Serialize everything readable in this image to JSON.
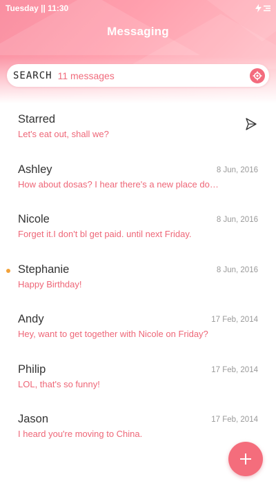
{
  "status_bar": {
    "time_text": "Tuesday || 11:30",
    "icons": [
      "charging-icon",
      "menu-lines-icon"
    ]
  },
  "header": {
    "title": "Messaging"
  },
  "search": {
    "label": "SEARCH",
    "count_text": "11 messages",
    "icon": "locate-icon"
  },
  "conversations": [
    {
      "name": "Starred",
      "preview": "Let's eat out, shall we?",
      "date": "",
      "unread": false,
      "icon": "send-icon"
    },
    {
      "name": "Ashley",
      "preview": "How about dosas? I hear there's a new place do…",
      "date": "8 Jun, 2016",
      "unread": false
    },
    {
      "name": "Nicole",
      "preview": "Forget it.I don't bl get paid. until next Friday.",
      "date": "8 Jun, 2016",
      "unread": false
    },
    {
      "name": "Stephanie",
      "preview": "Happy Birthday!",
      "date": "8 Jun, 2016",
      "unread": true
    },
    {
      "name": "Andy",
      "preview": "Hey, want to get together with Nicole on Friday?",
      "date": "17 Feb, 2014",
      "unread": false
    },
    {
      "name": "Philip",
      "preview": "LOL, that's so funny!",
      "date": "17 Feb, 2014",
      "unread": false
    },
    {
      "name": "Jason",
      "preview": "I heard you're moving to China.",
      "date": "17 Feb, 2014",
      "unread": false
    }
  ],
  "fab": {
    "icon": "plus-icon"
  },
  "colors": {
    "accent": "#f46d7c",
    "preview_text": "#ee6677",
    "unread_dot": "#f2a23a",
    "date_text": "#999999",
    "name_text": "#333333"
  }
}
